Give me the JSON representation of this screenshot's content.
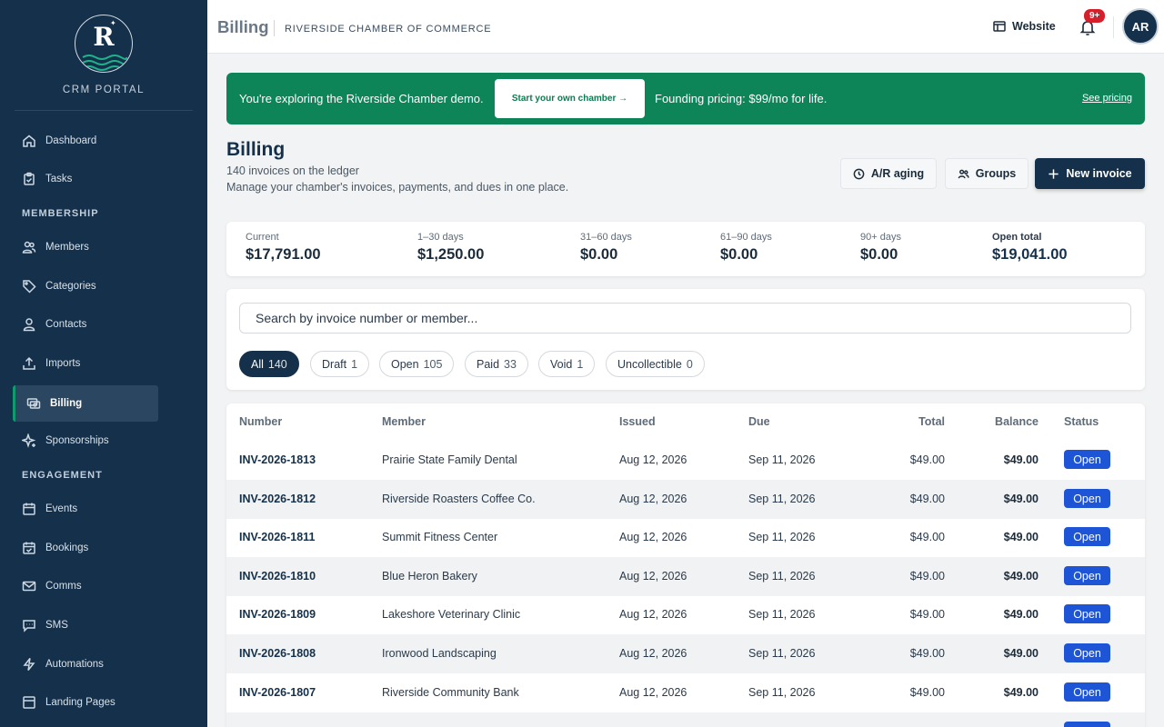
{
  "sidebar": {
    "portal_label": "CRM PORTAL",
    "sections": {
      "membership": "MEMBERSHIP",
      "engagement": "ENGAGEMENT"
    },
    "items": {
      "dashboard": "Dashboard",
      "tasks": "Tasks",
      "members": "Members",
      "categories": "Categories",
      "contacts": "Contacts",
      "imports": "Imports",
      "billing": "Billing",
      "sponsorships": "Sponsorships",
      "events": "Events",
      "bookings": "Bookings",
      "comms": "Comms",
      "sms": "SMS",
      "automations": "Automations",
      "landing_pages": "Landing Pages"
    },
    "active_item": "billing"
  },
  "header": {
    "title": "Billing",
    "org": "RIVERSIDE CHAMBER OF COMMERCE",
    "website_label": "Website",
    "notification_badge": "9+",
    "avatar_initials": "AR"
  },
  "banner": {
    "text": "You're exploring the Riverside Chamber demo.",
    "button_label": "Start your own chamber →",
    "pricing": "Founding pricing: $99/mo for life.",
    "link": "See pricing",
    "color": "#0e8559"
  },
  "page": {
    "title": "Billing",
    "count": "140 invoices on the ledger",
    "description": "Manage your chamber's invoices, payments, and dues in one place.",
    "buttons": {
      "ar_aging": "A/R aging",
      "groups": "Groups",
      "new_invoice": "New invoice"
    }
  },
  "aging": {
    "current": {
      "label": "Current",
      "value": "$17,791.00"
    },
    "d1_30": {
      "label": "1–30 days",
      "value": "$1,250.00"
    },
    "d31_60": {
      "label": "31–60 days",
      "value": "$0.00"
    },
    "d61_90": {
      "label": "61–90 days",
      "value": "$0.00"
    },
    "d90": {
      "label": "90+ days",
      "value": "$0.00"
    },
    "total": {
      "label": "Open total",
      "value": "$19,041.00"
    }
  },
  "filters": {
    "search_placeholder": "Search by invoice number or member...",
    "chips": [
      {
        "label": "All",
        "count": "140"
      },
      {
        "label": "Draft",
        "count": "1"
      },
      {
        "label": "Open",
        "count": "105"
      },
      {
        "label": "Paid",
        "count": "33"
      },
      {
        "label": "Void",
        "count": "1"
      },
      {
        "label": "Uncollectible",
        "count": "0"
      }
    ],
    "active": "All"
  },
  "table": {
    "columns": {
      "number": "Number",
      "member": "Member",
      "issued": "Issued",
      "due": "Due",
      "total": "Total",
      "balance": "Balance",
      "status": "Status"
    },
    "rows": [
      {
        "number": "INV-2026-1813",
        "member": "Prairie State Family Dental",
        "issued": "Aug 12, 2026",
        "due": "Sep 11, 2026",
        "total": "$49.00",
        "balance": "$49.00",
        "status": "Open"
      },
      {
        "number": "INV-2026-1812",
        "member": "Riverside Roasters Coffee Co.",
        "issued": "Aug 12, 2026",
        "due": "Sep 11, 2026",
        "total": "$49.00",
        "balance": "$49.00",
        "status": "Open"
      },
      {
        "number": "INV-2026-1811",
        "member": "Summit Fitness Center",
        "issued": "Aug 12, 2026",
        "due": "Sep 11, 2026",
        "total": "$49.00",
        "balance": "$49.00",
        "status": "Open"
      },
      {
        "number": "INV-2026-1810",
        "member": "Blue Heron Bakery",
        "issued": "Aug 12, 2026",
        "due": "Sep 11, 2026",
        "total": "$49.00",
        "balance": "$49.00",
        "status": "Open"
      },
      {
        "number": "INV-2026-1809",
        "member": "Lakeshore Veterinary Clinic",
        "issued": "Aug 12, 2026",
        "due": "Sep 11, 2026",
        "total": "$49.00",
        "balance": "$49.00",
        "status": "Open"
      },
      {
        "number": "INV-2026-1808",
        "member": "Ironwood Landscaping",
        "issued": "Aug 12, 2026",
        "due": "Sep 11, 2026",
        "total": "$49.00",
        "balance": "$49.00",
        "status": "Open"
      },
      {
        "number": "INV-2026-1807",
        "member": "Riverside Community Bank",
        "issued": "Aug 12, 2026",
        "due": "Sep 11, 2026",
        "total": "$49.00",
        "balance": "$49.00",
        "status": "Open"
      }
    ]
  },
  "colors": {
    "sidebar_bg": "#14304a",
    "accent": "#0f9b6c",
    "status_open": "#1e54d6",
    "alert": "#d5202b"
  },
  "icons": {
    "website": "browser-window-icon",
    "notifications": "bell-icon",
    "ar_aging": "clock-icon",
    "groups": "users-icon",
    "new_invoice": "plus-icon"
  }
}
